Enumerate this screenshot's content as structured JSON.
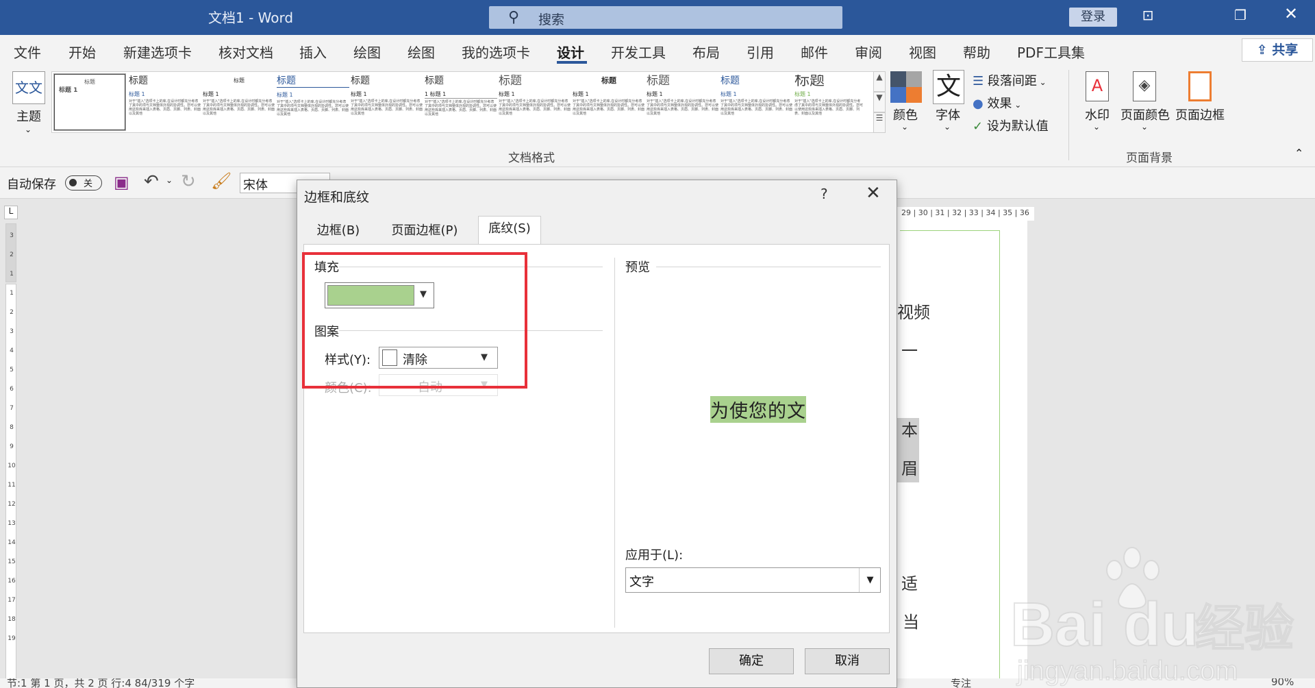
{
  "app": {
    "title": "文档1  -  Word",
    "search_placeholder": "搜索",
    "login": "登录",
    "share": "共享"
  },
  "tabs": [
    "文件",
    "开始",
    "新建选项卡",
    "核对文档",
    "插入",
    "绘图",
    "绘图",
    "我的选项卡",
    "设计",
    "开发工具",
    "布局",
    "引用",
    "邮件",
    "审阅",
    "视图",
    "帮助",
    "PDF工具集"
  ],
  "active_tab": "设计",
  "ribbon": {
    "theme_label": "主题",
    "theme_thumb_text": "文文",
    "styles": [
      {
        "title": "标题",
        "heading": "标题 1"
      },
      {
        "title": "标题",
        "heading": "标题 1"
      },
      {
        "title": "标题",
        "heading": "标题 1"
      },
      {
        "title": "标题",
        "heading": "标题 1"
      },
      {
        "title": "标题",
        "heading": "标题 1"
      },
      {
        "title": "标题",
        "heading": "1  标题 1"
      },
      {
        "title": "标题",
        "heading": "标题 1"
      },
      {
        "title": "标题",
        "heading": "标题 1"
      },
      {
        "title": "标题",
        "heading": "标题 1"
      },
      {
        "title": "标题",
        "heading": "标题 1"
      },
      {
        "title": "标题",
        "heading": "标题 1"
      }
    ],
    "body_snippet": "对于\"插入\"选项卡上的库,在设计时都充分考虑了其中的项与文档整体外观的协调性。您可以使用这些库来插入表格、页眉、页脚、列表、封面以及其他",
    "doc_format_group": "文档格式",
    "colors": "颜色",
    "fonts": "字体",
    "font_glyph": "文",
    "paragraph_spacing": "段落间距",
    "effects": "效果",
    "set_default": "设为默认值",
    "watermark": "水印",
    "page_color": "页面颜色",
    "page_borders": "页面边框",
    "page_bg_group": "页面背景"
  },
  "qat": {
    "autosave": "自动保存",
    "toggle": "关",
    "font": "宋体"
  },
  "ruler": {
    "top": "29 | 30 | 31 | 32 | 33 | 34 | 35 | 36",
    "left": [
      "3",
      "2",
      "1",
      "1",
      "2",
      "3",
      "4",
      "5",
      "6",
      "7",
      "8",
      "9",
      "10",
      "11",
      "12",
      "13",
      "14",
      "15",
      "16",
      "17",
      "18",
      "19"
    ]
  },
  "page_text": [
    "视频",
    "一",
    "本",
    "眉",
    "适",
    "当"
  ],
  "statusbar": {
    "text": "节:1    第 1 页，共 2 页    行:4    84/319 个字",
    "focus": "专注",
    "zoom": "90%"
  },
  "dialog": {
    "title": "边框和底纹",
    "help": "?",
    "tabs": [
      "边框(B)",
      "页面边框(P)",
      "底纹(S)"
    ],
    "fill_label": "填充",
    "fill_color": "#a9d18e",
    "pattern_label": "图案",
    "style_label": "样式(Y):",
    "style_value": "清除",
    "color_label": "颜色(C):",
    "color_value": "自动",
    "preview_label": "预览",
    "preview_text": "为使您的文",
    "apply_label": "应用于(L):",
    "apply_value": "文字",
    "ok": "确定",
    "cancel": "取消"
  },
  "watermark": {
    "brand": "Bai  du",
    "cn": "经验",
    "url": "jingyan.baidu.com"
  },
  "highlight_color": "#e8303a"
}
